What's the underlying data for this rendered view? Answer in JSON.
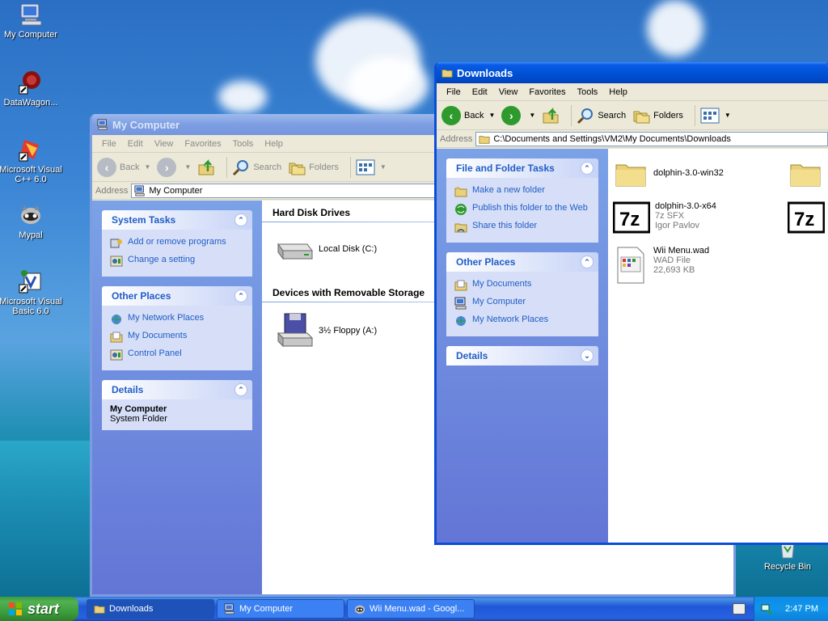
{
  "desktop": {
    "icons": [
      {
        "label": "My Computer"
      },
      {
        "label": "DataWagon..."
      },
      {
        "label": "Microsoft Visual C++ 6.0"
      },
      {
        "label": "Mypal"
      },
      {
        "label": "Microsoft Visual Basic 6.0"
      },
      {
        "label": "Recycle Bin"
      }
    ]
  },
  "window_mycomputer": {
    "title": "My Computer",
    "menu": [
      "File",
      "Edit",
      "View",
      "Favorites",
      "Tools",
      "Help"
    ],
    "toolbar": {
      "back": "Back",
      "search": "Search",
      "folders": "Folders"
    },
    "address": {
      "label": "Address",
      "value": "My Computer"
    },
    "panels": {
      "system_tasks": {
        "title": "System Tasks",
        "items": [
          "Add or remove programs",
          "Change a setting"
        ]
      },
      "other_places": {
        "title": "Other Places",
        "items": [
          "My Network Places",
          "My Documents",
          "Control Panel"
        ]
      },
      "details": {
        "title": "Details",
        "name": "My Computer",
        "type": "System Folder"
      }
    },
    "groups": {
      "hard_disk": {
        "title": "Hard Disk Drives",
        "items": [
          "Local Disk (C:)"
        ]
      },
      "removable": {
        "title": "Devices with Removable Storage",
        "items": [
          "3½ Floppy (A:)"
        ]
      }
    }
  },
  "window_downloads": {
    "title": "Downloads",
    "menu": [
      "File",
      "Edit",
      "View",
      "Favorites",
      "Tools",
      "Help"
    ],
    "toolbar": {
      "back": "Back",
      "search": "Search",
      "folders": "Folders"
    },
    "address": {
      "label": "Address",
      "value": "C:\\Documents and Settings\\VM2\\My Documents\\Downloads"
    },
    "panels": {
      "file_tasks": {
        "title": "File and Folder Tasks",
        "items": [
          "Make a new folder",
          "Publish this folder to the Web",
          "Share this folder"
        ]
      },
      "other_places": {
        "title": "Other Places",
        "items": [
          "My Documents",
          "My Computer",
          "My Network Places"
        ]
      },
      "details": {
        "title": "Details"
      }
    },
    "files": [
      {
        "name": "dolphin-3.0-win32",
        "line2": "",
        "line3": "",
        "icon": "folder-icon"
      },
      {
        "name": "dolphin-3.0-x64",
        "line2": "7z SFX",
        "line3": "Igor Pavlov",
        "icon": "7zip-icon"
      },
      {
        "name": "Wii Menu.wad",
        "line2": "WAD File",
        "line3": "22,693 KB",
        "icon": "wad-file-icon"
      }
    ]
  },
  "taskbar": {
    "start": "start",
    "buttons": [
      "Downloads",
      "My Computer",
      "Wii Menu.wad - Googl..."
    ],
    "clock": "2:47 PM"
  }
}
